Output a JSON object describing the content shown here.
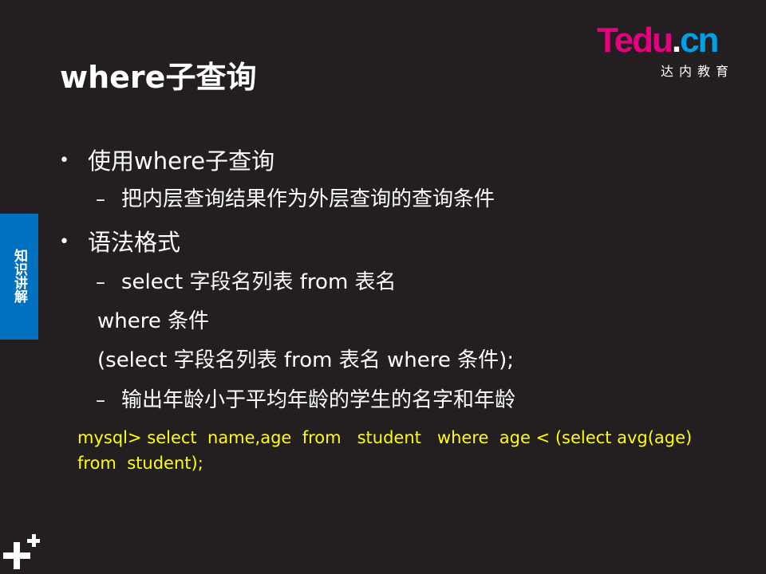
{
  "logo": {
    "main": "Tedu",
    "dot": ".",
    "suffix": "cn",
    "subtitle": "达内教育",
    "colors": {
      "primary": "#e6007e",
      "secondary": "#00a0e9"
    }
  },
  "title": "where子查询",
  "side_tab": {
    "label": "知识讲解",
    "color": "#0070c0"
  },
  "bullets": [
    {
      "text": "使用where子查询",
      "subitems": [
        "把内层查询结果作为外层查询的查询条件"
      ]
    },
    {
      "text": "语法格式",
      "subitems": [
        "select   字段名列表   from  表名",
        "where   条件",
        "(select  字段名列表   from  表名   where 条件);",
        "输出年龄小于平均年龄的学生的名字和年龄"
      ]
    }
  ],
  "code": {
    "line1": "mysql> select  name,age  from   student   where  age < (select avg(age)",
    "line2": "from  student);",
    "color": "#ffff00"
  },
  "corner_icon": "plus-plus-icon"
}
